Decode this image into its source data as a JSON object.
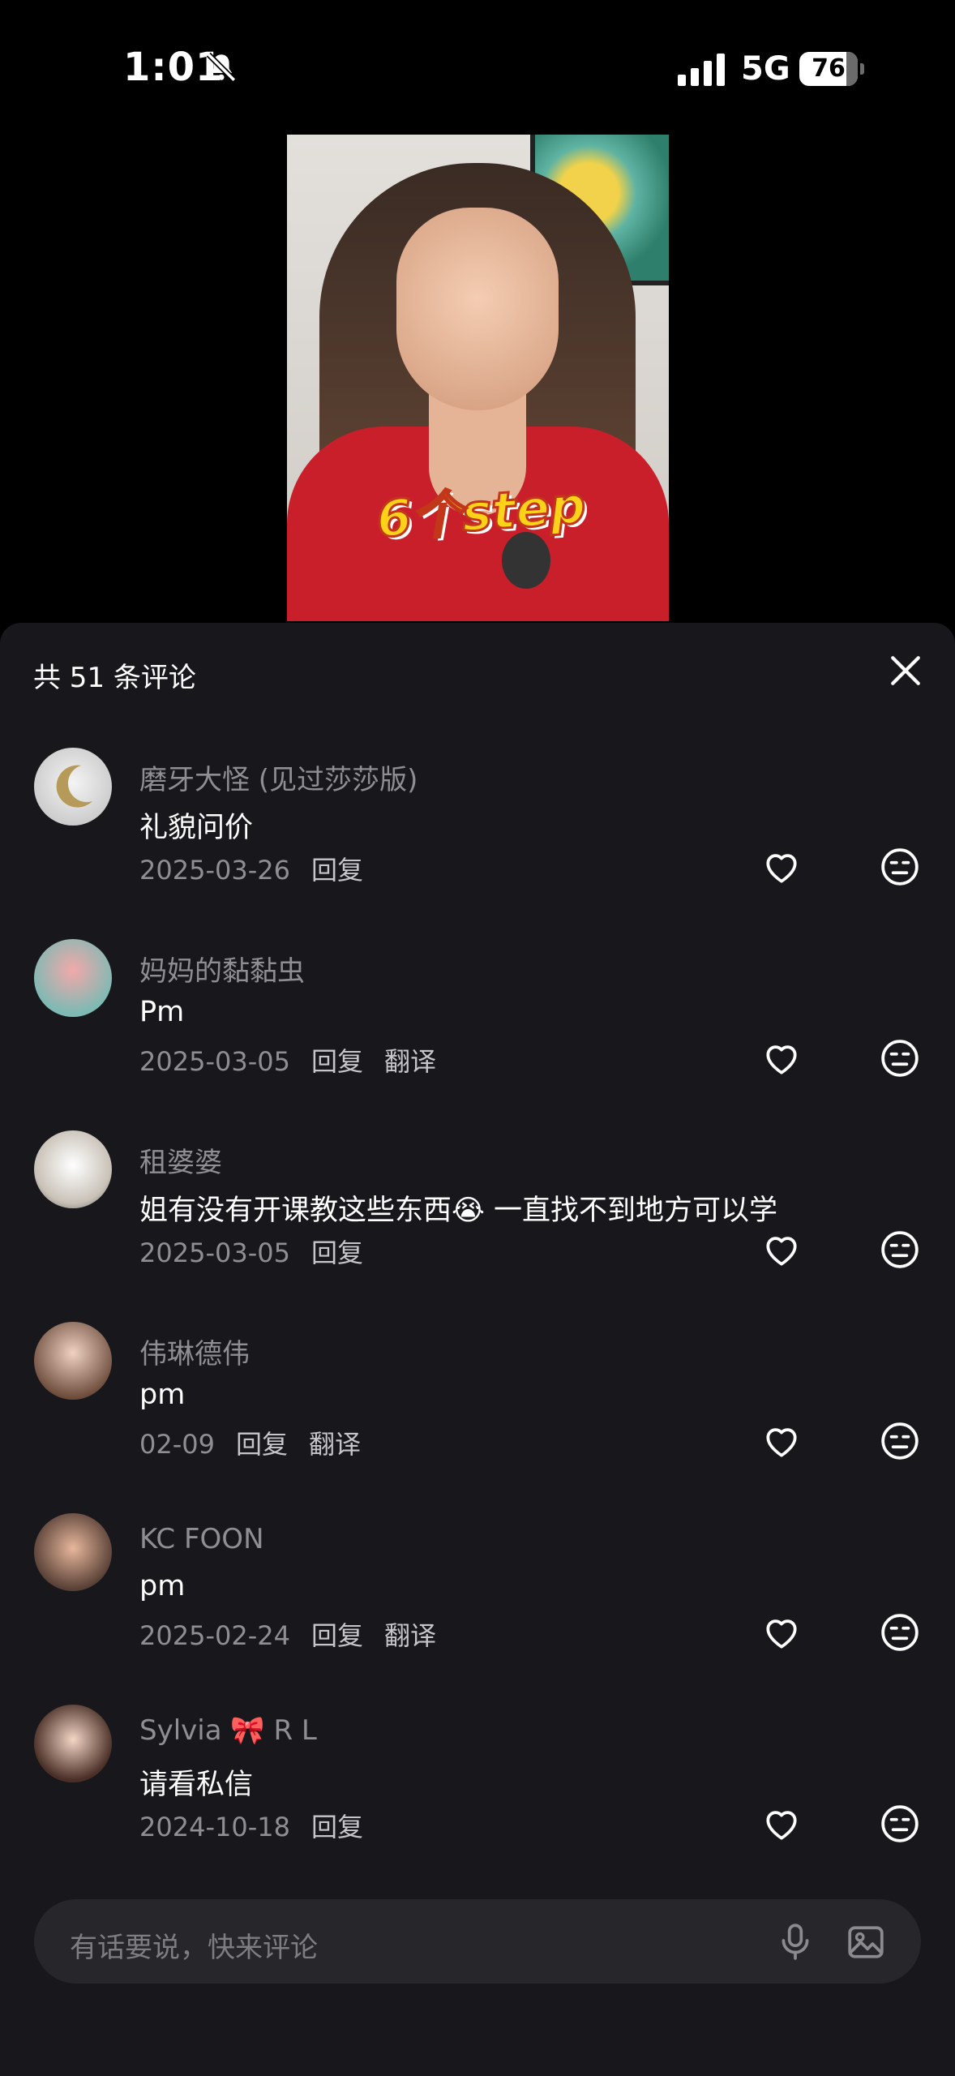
{
  "status_bar": {
    "time": "1:01",
    "network": "5G",
    "battery": "76"
  },
  "video": {
    "sticker_text": "6个step"
  },
  "comments_panel": {
    "title": "共 51 条评论",
    "comments": [
      {
        "name": "磨牙大怪 (见过莎莎版)",
        "text": "礼貌问价",
        "date": "2025-03-26",
        "actions": [
          "回复"
        ]
      },
      {
        "name": "妈妈的黏黏虫",
        "text": "Pm",
        "date": "2025-03-05",
        "actions": [
          "回复",
          "翻译"
        ]
      },
      {
        "name": "租婆婆",
        "text": "姐有没有开课教这些东西😭 一直找不到地方可以学",
        "date": "2025-03-05",
        "actions": [
          "回复"
        ]
      },
      {
        "name": "伟琳德伟",
        "text": "pm",
        "date": "02-09",
        "actions": [
          "回复",
          "翻译"
        ]
      },
      {
        "name": "KC FOON",
        "text": "pm",
        "date": "2025-02-24",
        "actions": [
          "回复",
          "翻译"
        ]
      },
      {
        "name": "Sylvia 🎀 R L",
        "text": "请看私信",
        "date": "2024-10-18",
        "actions": [
          "回复"
        ]
      }
    ]
  },
  "input": {
    "placeholder": "有话要说，快来评论"
  },
  "colors": {
    "sheet_bg": "#18181c",
    "input_bg": "#26262b",
    "muted_text": "#8f8f93"
  }
}
